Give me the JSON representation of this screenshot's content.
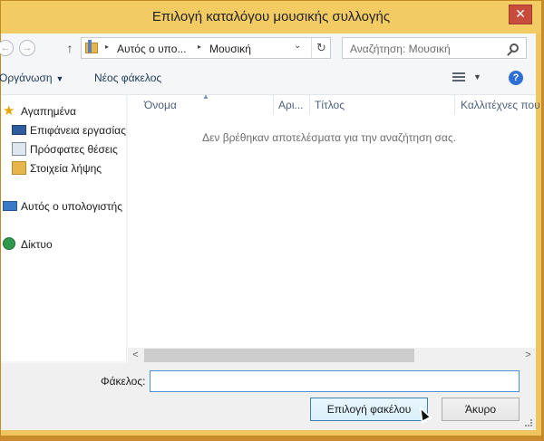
{
  "window": {
    "title": "Επιλογή καταλόγου μουσικής συλλογής",
    "close_glyph": "✕"
  },
  "navigation": {
    "back_glyph": "←",
    "forward_glyph": "→",
    "up_glyph": "↑",
    "breadcrumbs": [
      "Αυτός ο υπο...",
      "Μουσική"
    ],
    "breadcrumb_separator": "▸",
    "dropdown_glyph": "⌄",
    "refresh_glyph": "↻"
  },
  "search": {
    "placeholder": "Αναζήτηση: Μουσική"
  },
  "toolbar": {
    "organize_label": "Οργάνωση",
    "organize_arrow": "▼",
    "new_folder_label": "Νέος φάκελος",
    "view_arrow": "▼",
    "help_glyph": "?"
  },
  "sidebar": {
    "items": [
      {
        "label": "Αγαπημένα",
        "icon": "star-icon"
      },
      {
        "label": "Επιφάνεια εργασίας",
        "icon": "desktop-icon"
      },
      {
        "label": "Πρόσφατες θέσεις",
        "icon": "recent-places-icon"
      },
      {
        "label": "Στοιχεία λήψης",
        "icon": "downloads-icon"
      },
      {
        "label": "Αυτός ο υπολογιστής",
        "icon": "computer-icon"
      },
      {
        "label": "Δίκτυο",
        "icon": "network-icon"
      }
    ],
    "star_glyph": "★"
  },
  "file_list": {
    "columns": [
      "Όνομα",
      "Αρι...",
      "Τίτλος",
      "Καλλιτέχνες που"
    ],
    "sort_glyph": "▲",
    "empty_message": "Δεν βρέθηκαν αποτελέσματα για την αναζήτηση σας."
  },
  "scrollbar": {
    "left_glyph": "<",
    "right_glyph": ">"
  },
  "footer": {
    "folder_label": "Φάκελος:",
    "folder_value": "",
    "select_button": "Επιλογή φακέλου",
    "cancel_button": "Άκυρο"
  },
  "colors": {
    "title_bar": "#f3cb63",
    "close_button": "#c74c3c",
    "accent": "#1e395b"
  }
}
